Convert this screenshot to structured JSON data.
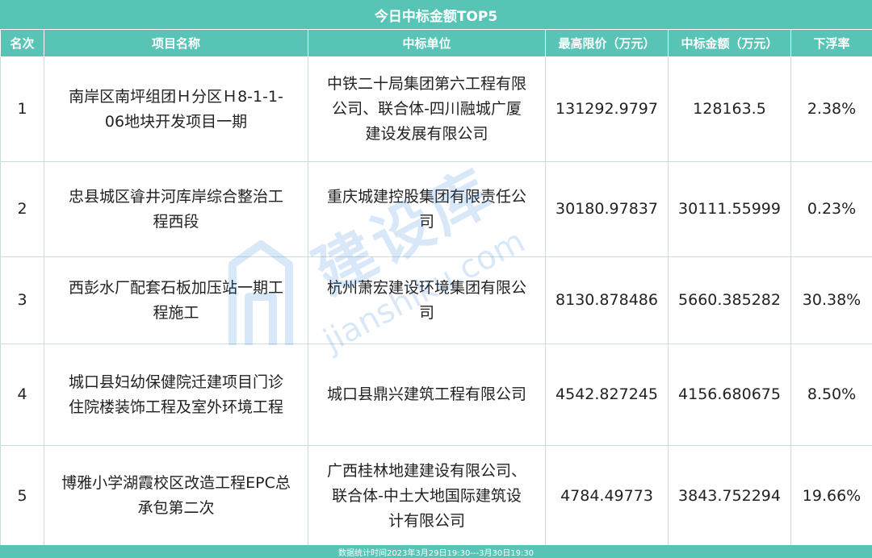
{
  "title": "今日中标金额TOP5",
  "headers": [
    "名次",
    "项目名称",
    "中标单位",
    "最高限价（万元）",
    "中标金额（万元）",
    "下浮率"
  ],
  "rows": [
    {
      "rank": "1",
      "project_lines": [
        "南岸区南坪组团Ｈ分区Ｈ8-1-1-",
        "06地块开发项目一期"
      ],
      "winner_lines": [
        "中铁二十局集团第六工程有限",
        "公司、联合体-四川融城广厦",
        "建设发展有限公司"
      ],
      "max_price": "131292.9797",
      "bid_amount": "128163.5",
      "rate": "2.38%"
    },
    {
      "rank": "2",
      "project_lines": [
        "忠县城区㽏井河库岸综合整治工",
        "程西段"
      ],
      "winner_lines": [
        "重庆城建控股集团有限责任公",
        "司"
      ],
      "max_price": "30180.97837",
      "bid_amount": "30111.55999",
      "rate": "0.23%"
    },
    {
      "rank": "3",
      "project_lines": [
        "西彭水厂配套石板加压站一期工",
        "程施工"
      ],
      "winner_lines": [
        "杭州萧宏建设环境集团有限公",
        "司"
      ],
      "max_price": "8130.878486",
      "bid_amount": "5660.385282",
      "rate": "30.38%"
    },
    {
      "rank": "4",
      "project_lines": [
        "城口县妇幼保健院迁建项目门诊",
        "住院楼装饰工程及室外环境工程"
      ],
      "winner_lines": [
        "城口县鼎兴建筑工程有限公司"
      ],
      "max_price": "4542.827245",
      "bid_amount": "4156.680675",
      "rate": "8.50%"
    },
    {
      "rank": "5",
      "project_lines": [
        "博雅小学湖霞校区改造工程EPC总",
        "承包第二次"
      ],
      "winner_lines": [
        "广西桂林地建建设有限公司、",
        "联合体-中土大地国际建筑设",
        "计有限公司"
      ],
      "max_price": "4784.49773",
      "bid_amount": "3843.752294",
      "rate": "19.66%"
    }
  ],
  "footer": "数据统计时间2023年3月29日19:30---3月30日19:30",
  "watermark": {
    "text": "建设库",
    "url": "jianshiku.com",
    "logo_icon": "building-logo-icon"
  },
  "colors": {
    "header_bg": "#57c4b6",
    "header_text": "#ffffff",
    "border": "#c9ddda",
    "watermark": "#1a73d9"
  }
}
